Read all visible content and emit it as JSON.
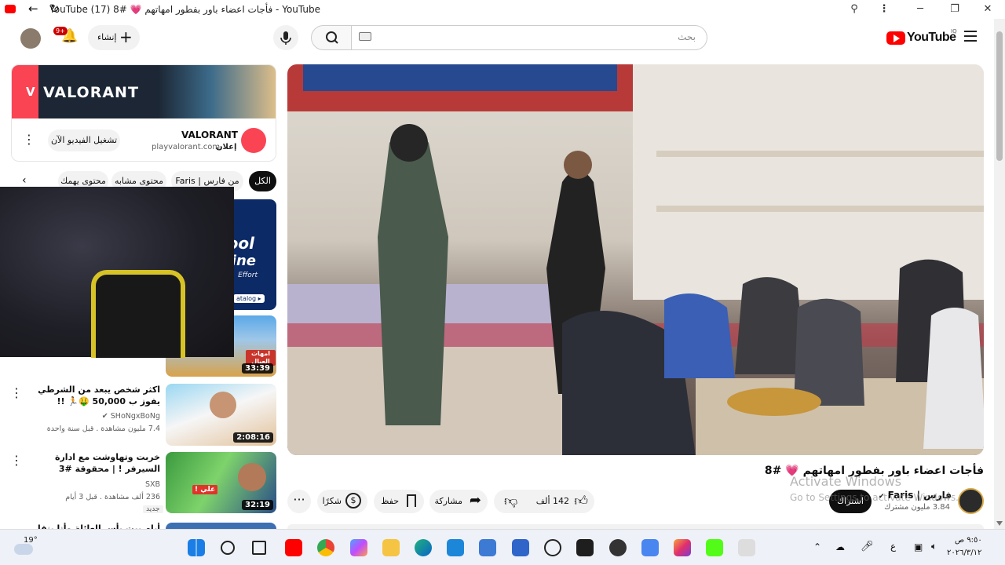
{
  "browser": {
    "tab_title": "YouTube - فأجات اعضاء باور بفطور امهاتهم 💗 #8 (17) YouTube",
    "minimize": "─",
    "maximize": "❐",
    "close": "✕"
  },
  "header": {
    "logo": "YouTube",
    "country": "IQ",
    "search_placeholder": "بحث",
    "create_label": "إنشاء",
    "notif_count": "9+"
  },
  "ad": {
    "banner_text": "VALORANT",
    "title": "VALORANT",
    "sponsored": "إعلان",
    "domain": "playvalorant.com",
    "cta": "تشغيل الفيديو الآن"
  },
  "chips": [
    "الكل",
    "من فارس | Faris",
    "محتوى مشابه",
    "محتوى يهمك"
  ],
  "videos": [
    {
      "title": "امهات العيال",
      "duration": "33:39"
    },
    {
      "title": "اكثر شخص يبعد من الشرطي يفوز ب 50,000 🤑🏃 !!",
      "channel": "SHoNgxBoNg",
      "meta": "7.4 مليون مشاهدة . قبل سنة واحدة",
      "duration": "2:08:16"
    },
    {
      "title": "خربت وتهاوشت مع ادارة السيرفر ! | محقوقة #3",
      "channel": "SXB",
      "meta": "236 ألف مشاهدة . قبل 3 أيام",
      "badge": "جديد",
      "duration": "32:19"
    },
    {
      "title": "أيام بيت بأس العائلة وأنا ينقل ... عائلي"
    }
  ],
  "thumb_text": {
    "pool": "Pool",
    "line": "line",
    "effort": "Effort",
    "catalog": "atalog ▸",
    "ali": "علي !",
    "amhat": "امهات العيال"
  },
  "main": {
    "title": "فأجات اعضاء باور بفطور امهاتهم 💗 #8",
    "channel": "فارس | Faris",
    "subs": "3.84 مليون مشترك",
    "subscribe": "اشتراك",
    "likes": "142 ألف",
    "share": "مشاركة",
    "save": "حفظ",
    "thanks": "شكرًا",
    "watermark_line1": "Activate Windows",
    "watermark_line2": "Go to Settings to activate Windows."
  },
  "taskbar": {
    "temp": "19°",
    "lang": "ع",
    "time": "٩:٥٠ ص",
    "date": "٢٠٢٦/٣/١٢"
  }
}
